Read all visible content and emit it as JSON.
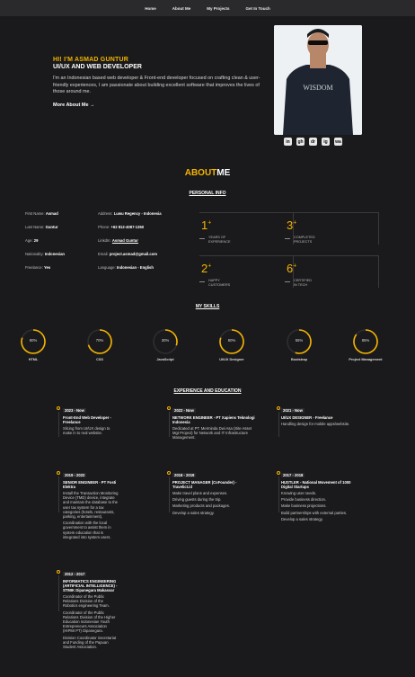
{
  "nav": {
    "items": [
      "Home",
      "About Me",
      "My Projects",
      "Get In Touch"
    ]
  },
  "hero": {
    "greeting": "HI! I'M ASMAD GUNTUR",
    "role": "UI/UX AND WEB DEVELOPER",
    "description": "I'm an Indonesian based web developer & Front-end developer focused on crafting clean & user-friendly experiences, I am passionate about building excellent software that improves the lives of those around me.",
    "more_label": "More About Me →",
    "shirt_text": "WISDOM",
    "socials": [
      "in",
      "gh",
      "dr",
      "ig",
      "wa"
    ]
  },
  "about": {
    "title_a": "ABOUT",
    "title_b": "ME",
    "personal_heading": "PERSONAL INFO",
    "left": [
      {
        "k": "First Name:",
        "v": "Asmad"
      },
      {
        "k": "Last Name:",
        "v": "Guntur"
      },
      {
        "k": "Age:",
        "v": "29"
      },
      {
        "k": "Nationality:",
        "v": "Indonesian"
      },
      {
        "k": "Freelance:",
        "v": "Yes"
      }
    ],
    "right": [
      {
        "k": "Address:",
        "v": "Luwu Regency - Indonesia"
      },
      {
        "k": "Phone:",
        "v": "+62 812-4087-1350"
      },
      {
        "k": "LinkdIn:",
        "v": "Asmad Guntur"
      },
      {
        "k": "Email:",
        "v": "project.asmad@gmail.com"
      },
      {
        "k": "Language:",
        "v": "Indonesian - English"
      }
    ],
    "stats": [
      {
        "num": "1",
        "label1": "YEARS OF",
        "label2": "EXPERIENCE"
      },
      {
        "num": "3",
        "label1": "COMPLETED",
        "label2": "PROJECTS"
      },
      {
        "num": "2",
        "label1": "HAPPY",
        "label2": "CUSTOMERS"
      },
      {
        "num": "6",
        "label1": "CERTIFIED",
        "label2": "IN TECH"
      }
    ]
  },
  "skills": {
    "heading": "MY SKILLS",
    "items": [
      {
        "name": "HTML",
        "pct": 80,
        "txt": "80%"
      },
      {
        "name": "CSS",
        "pct": 70,
        "txt": "70%"
      },
      {
        "name": "JavaScript",
        "pct": 30,
        "txt": "30%"
      },
      {
        "name": "UI/UX Designer",
        "pct": 80,
        "txt": "80%"
      },
      {
        "name": "Bootstrap",
        "pct": 55,
        "txt": "55%"
      },
      {
        "name": "Project Management",
        "pct": 85,
        "txt": "85%"
      }
    ],
    "accent": "#f4b400"
  },
  "experience": {
    "heading": "EXPERIENCE AND EDUCATION",
    "col1": [
      {
        "date": "2023 - Now",
        "title": "Front-End Web Developer - Freelance",
        "desc": [
          "Slicing from UI/UX design to make in to real website."
        ]
      },
      {
        "date": "2019 - 2022",
        "title": "SENIOR ENGINEER - PT Fosti Elektra",
        "desc": [
          "Install the Transaction Monitoring Device (TMD) device, integrate and maintain the database to the user tax system for a tax categories (hotels, restaurants, parking, entertainment).",
          "Coordination with the local government to assist them in system education that is integrated into system users."
        ]
      },
      {
        "date": "2012 - 2017",
        "title": "INFORMATICS ENGINEERING (ARTIFICIAL INTELLIGENCE) - STMIK Dipanegara Makassar",
        "desc": [
          "Coordinator of the Public Relations Division of the Robotics engineering Team.",
          "Coordinator of the Public Relations Division of the Higher Education Indonesian Youth Entrepreneurs Association (HIPMI PT) Dipanegara.",
          "Division Coordinator Secretariat and Funding of the Papuan Student Association."
        ]
      }
    ],
    "col2": [
      {
        "date": "2022 - Now",
        "title": "NETWORK ENGINEER - PT Xapiens Teknologi Indonesia",
        "desc": [
          "Dedicated at PT. Merminda Dwi Asa (Site Asset Mgt Project) for Network and IT Infrastructure Management."
        ]
      },
      {
        "date": "2018 - 2019",
        "title": "PROJECT MANAGER (CoFounder) - Travelict.id",
        "desc": [
          "Make travel plans and expenses.",
          "Driving guests during the trip.",
          "Marketing products and packages.",
          "Develop a sales strategy."
        ]
      }
    ],
    "col3": [
      {
        "date": "2021 - Now",
        "title": "UI/UX DESIGNER - Freelance",
        "desc": [
          "Handling design for mobile apps/website."
        ]
      },
      {
        "date": "2017 - 2018",
        "title": "HUSTLER - National Movement of 1000 Digital Startups",
        "desc": [
          "Knowing user needs.",
          "Provide business direction.",
          "Make business projections.",
          "Build partnerships with external parties.",
          "Develop a sales strategy."
        ]
      }
    ]
  }
}
